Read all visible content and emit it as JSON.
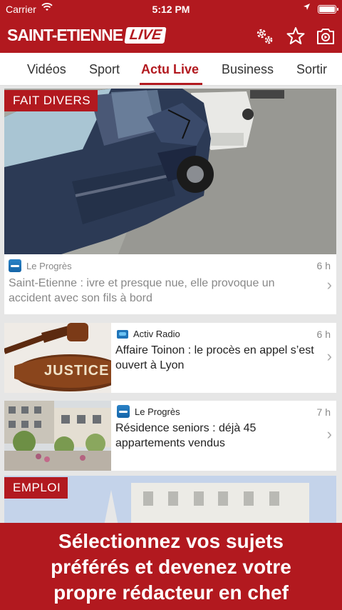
{
  "status_bar": {
    "carrier": "Carrier",
    "time": "5:12 PM"
  },
  "header": {
    "logo_text": "SAINT-ETIENNE",
    "logo_badge": "LIVE"
  },
  "tabs": [
    {
      "label": "Vidéos"
    },
    {
      "label": "Sport"
    },
    {
      "label": "Actu Live",
      "active": true
    },
    {
      "label": "Business"
    },
    {
      "label": "Sortir"
    }
  ],
  "articles": [
    {
      "tag": "FAIT DIVERS",
      "source": "Le Progrès",
      "time": "6 h",
      "title": "Saint-Etienne : ivre et presque nue, elle provoque un accident avec son fils à bord"
    },
    {
      "source": "Activ Radio",
      "time": "6 h",
      "title": "Affaire Toinon : le procès en appel s’est ouvert à Lyon",
      "image_text": "JUSTICE"
    },
    {
      "source": "Le Progrès",
      "time": "7 h",
      "title": "Résidence seniors : déjà 45 appartements vendus"
    },
    {
      "tag": "EMPLOI"
    }
  ],
  "promo": {
    "line1": "Sélectionnez vos sujets",
    "line2": "préférés et devenez votre",
    "line3": "propre rédacteur en chef"
  },
  "icons": [
    "wifi-icon",
    "location-arrow-icon",
    "battery-icon",
    "settings-gears-icon",
    "star-icon",
    "camera-icon",
    "chevron-right-icon"
  ],
  "colors": {
    "brand": "#b2191f",
    "muted_text": "#888888",
    "text": "#222222"
  }
}
